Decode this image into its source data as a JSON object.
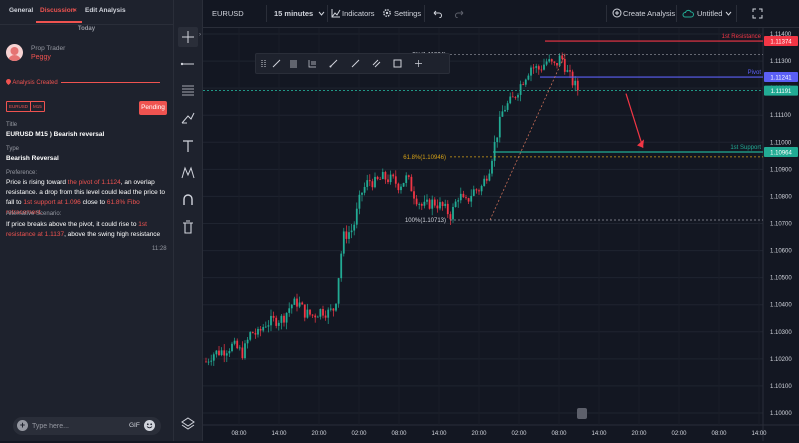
{
  "left_panel": {
    "tabs": [
      {
        "label": "General",
        "active": false
      },
      {
        "label": "Discussion",
        "active": true,
        "close": "×"
      },
      {
        "label": "Edit Analysis",
        "active": false
      }
    ],
    "date_divider": "Today",
    "author": {
      "role": "Prop Trader",
      "name": "Peggy"
    },
    "status": "Analysis Created",
    "tags": [
      "EURUSD",
      "M15"
    ],
    "pending_label": "Pending",
    "title_label": "Title",
    "title_value": "EURUSD M15 ) Bearish reversal",
    "type_label": "Type",
    "type_value": "Bearish Reversal",
    "preference_label": "Preference:",
    "preference_text": [
      {
        "t": "Price is rising toward ",
        "hl": false
      },
      {
        "t": "the pivot of 1.1124",
        "hl": true
      },
      {
        "t": ", an overlap resistance. a drop from this level could lead the price to fall to ",
        "hl": false
      },
      {
        "t": "1st support at 1.096",
        "hl": true
      },
      {
        "t": " close to ",
        "hl": false
      },
      {
        "t": "61.8% Fibo retracement.",
        "hl": true
      }
    ],
    "alt_label": "Alternative Scenario:",
    "alt_text": [
      {
        "t": "If price breaks above the pivot, it could rise to ",
        "hl": false
      },
      {
        "t": "1st resistance at 1.1137",
        "hl": true
      },
      {
        "t": ", above the swing high resistance",
        "hl": false
      }
    ],
    "time": "11:28",
    "comment": {
      "placeholder": "Type here...",
      "gif_label": "GIF"
    }
  },
  "topbar": {
    "symbol": "EURUSD",
    "interval": "15 minutes",
    "indicators_label": "Indicators",
    "settings_label": "Settings",
    "create_label": "Create Analysis",
    "untitled_label": "Untitled"
  },
  "chart": {
    "price_ticks": [
      "1.11400",
      "1.11300",
      "1.11200",
      "1.11100",
      "1.11000",
      "1.10900",
      "1.10800",
      "1.10700",
      "1.10600",
      "1.10500",
      "1.10400",
      "1.10300",
      "1.10200",
      "1.10100",
      "1.10000"
    ],
    "time_ticks": [
      "08:00",
      "14:00",
      "20:00",
      "02:00",
      "08:00",
      "14:00",
      "20:00",
      "02:00",
      "08:00",
      "14:00",
      "20:00",
      "02:00",
      "08:00",
      "14:00"
    ],
    "levels": {
      "resistance": {
        "label": "1st Resistance",
        "price": "1.11374",
        "color": "#f23645"
      },
      "pivot": {
        "label": "Pivot",
        "price": "1.11241",
        "color": "#5b5ff5"
      },
      "support": {
        "label": "1st Support",
        "price": "1.10964",
        "color": "#22ab94"
      },
      "current": {
        "price": "1.11191",
        "color": "#22ab94"
      }
    },
    "fib": {
      "f0": "0%(1.11324)",
      "f618": "61.8%(1.10946)",
      "f100": "100%(1.10713)"
    }
  }
}
